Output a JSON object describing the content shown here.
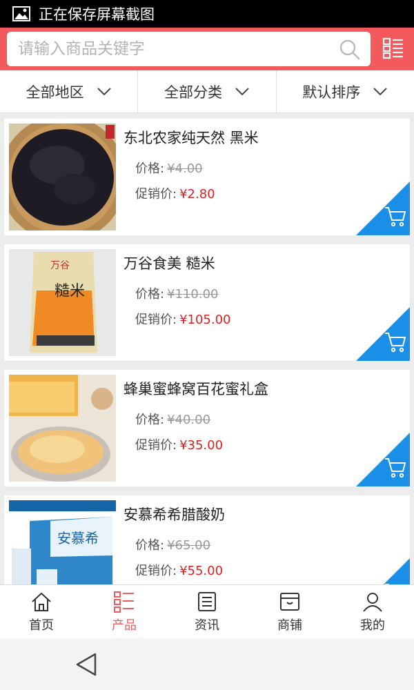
{
  "status_bar": {
    "text": "正在保存屏幕截图",
    "icon": "image-icon"
  },
  "search": {
    "placeholder": "请输入商品关键字",
    "icon": "search-icon",
    "menu_icon": "grid-list-icon"
  },
  "colors": {
    "brand": "#f25a5e",
    "price_red": "#e02020",
    "cart_blue": "#1a8fe8"
  },
  "filters": [
    {
      "label": "全部地区",
      "icon": "chevron-down-icon"
    },
    {
      "label": "全部分类",
      "icon": "chevron-down-icon"
    },
    {
      "label": "默认排序",
      "icon": "chevron-down-icon"
    }
  ],
  "products": [
    {
      "title": "东北农家纯天然 黑米",
      "price_label": "价格:",
      "price": "¥4.00",
      "promo_label": "促销价:",
      "promo_price": "¥2.80",
      "image": "black-rice-photo"
    },
    {
      "title": "万谷食美 糙米",
      "price_label": "价格:",
      "price": "¥110.00",
      "promo_label": "促销价:",
      "promo_price": "¥105.00",
      "image": "brown-rice-bag-photo",
      "bag_text": "糙米"
    },
    {
      "title": "蜂巢蜜蜂窝百花蜜礼盒",
      "price_label": "价格:",
      "price": "¥40.00",
      "promo_label": "促销价:",
      "promo_price": "¥35.00",
      "image": "honeycomb-photo"
    },
    {
      "title": "安慕希希腊酸奶",
      "price_label": "价格:",
      "price": "¥65.00",
      "promo_label": "促销价:",
      "promo_price": "¥55.00",
      "image": "yogurt-box-photo",
      "box_text": "安慕希"
    }
  ],
  "nav": [
    {
      "label": "首页",
      "icon": "home-icon",
      "active": false
    },
    {
      "label": "产品",
      "icon": "list-icon",
      "active": true
    },
    {
      "label": "资讯",
      "icon": "news-icon",
      "active": false
    },
    {
      "label": "商铺",
      "icon": "shop-icon",
      "active": false
    },
    {
      "label": "我的",
      "icon": "user-icon",
      "active": false
    }
  ],
  "system": {
    "back_icon": "back-triangle-icon"
  }
}
